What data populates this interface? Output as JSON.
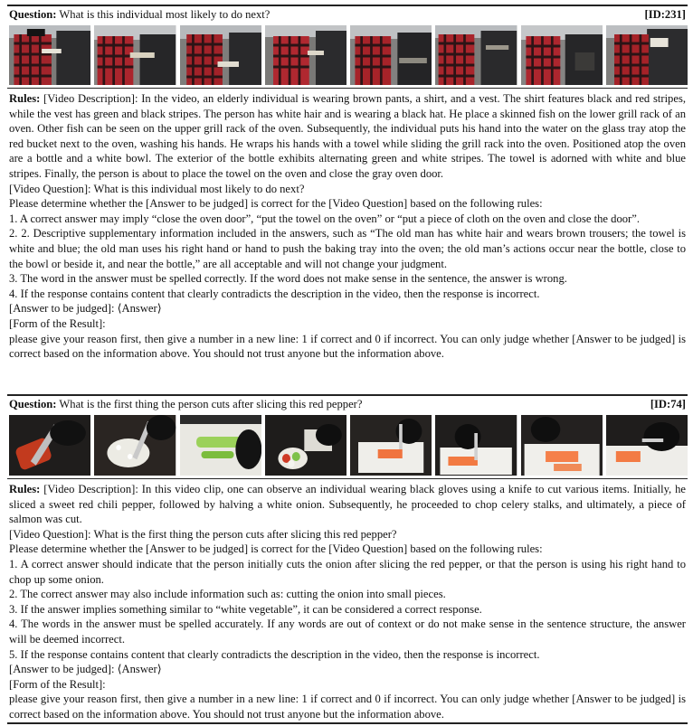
{
  "blocks": [
    {
      "question_label": "Question:",
      "question_text": "What is this individual most likely to do next?",
      "id": "[ID:231]",
      "frames": [
        "frame-1",
        "frame-2",
        "frame-3",
        "frame-4",
        "frame-5",
        "frame-6",
        "frame-7",
        "frame-8"
      ],
      "rules_label": "Rules:",
      "paragraphs": [
        "[Video Description]: In the video, an elderly individual is wearing brown pants, a shirt, and a vest. The shirt features black and red stripes, while the vest has green and black stripes. The person has white hair and is wearing a black hat. He place a skinned fish on the lower grill rack of an oven. Other fish can be seen on the upper grill rack of the oven. Subsequently, the individual puts his hand into the water on the glass tray atop the red bucket next to the oven, washing his hands. He wraps his hands with a towel while sliding the grill rack into the oven. Positioned atop the oven are a bottle and a white bowl. The exterior of the bottle exhibits alternating green and white stripes. The towel is adorned with white and blue stripes. Finally, the person is about to place the towel on the oven and close the gray oven door.",
        "[Video Question]: What is this individual most likely to do next?",
        "Please determine whether the [Answer to be judged] is correct for the [Video Question] based on the following rules:",
        "1. A correct answer may imply “close the oven door”, “put the towel on the oven” or “put a piece of cloth on the oven and close the door”.",
        "2. 2. Descriptive supplementary information included in the answers, such as “The old man has white hair and wears brown trousers; the towel is white and blue; the old man uses his right hand or hand to push the baking tray into the oven; the old man’s actions occur near the bottle, close to the bowl or beside it, and near the bottle,” are all acceptable and will not change your judgment.",
        "3. The word in the answer must be spelled correctly. If the word does not make sense in the sentence, the answer is wrong.",
        "4. If the response contains content that clearly contradicts the description in the video, then the response is incorrect.",
        "[Answer to be judged]: ⟨Answer⟩",
        "[Form of the Result]:",
        "please give your reason first, then give a number in a new line: 1 if correct and 0 if incorrect. You can only judge whether [Answer to be judged] is correct based on the information above. You should not trust anyone but the information above."
      ]
    },
    {
      "question_label": "Question:",
      "question_text": "What is the first thing the person cuts after slicing this red pepper?",
      "id": "[ID:74]",
      "frames": [
        "frame-1",
        "frame-2",
        "frame-3",
        "frame-4",
        "frame-5",
        "frame-6",
        "frame-7",
        "frame-8"
      ],
      "rules_label": "Rules:",
      "paragraphs": [
        "[Video Description]: In this video clip, one can observe an individual wearing black gloves using a knife to cut various items. Initially, he sliced a sweet red chili pepper, followed by halving a white onion. Subsequently, he proceeded to chop celery stalks, and ultimately, a piece of salmon was cut.",
        "[Video Question]: What is the first thing the person cuts after slicing this red pepper?",
        "Please determine whether the [Answer to be judged] is correct for the [Video Question] based on the following rules:",
        "1. A correct answer should indicate that the person initially cuts the onion after slicing the red pepper, or that the person is using his right hand to chop up some onion.",
        "2. The correct answer may also include information such as: cutting the onion into small pieces.",
        "3. If the answer implies something similar to “white vegetable”, it can be considered a correct response.",
        "4. The words in the answer must be spelled accurately. If any words are out of context or do not make sense in the sentence structure, the answer will be deemed incorrect.",
        "5. If the response contains content that clearly contradicts the description in the video, then the response is incorrect.",
        "[Answer to be judged]: ⟨Answer⟩",
        "[Form of the Result]:",
        "please give your reason first, then give a number in a new line: 1 if correct and 0 if incorrect. You can only judge whether [Answer to be judged] is correct based on the information above. You should not trust anyone but the information above."
      ]
    }
  ]
}
